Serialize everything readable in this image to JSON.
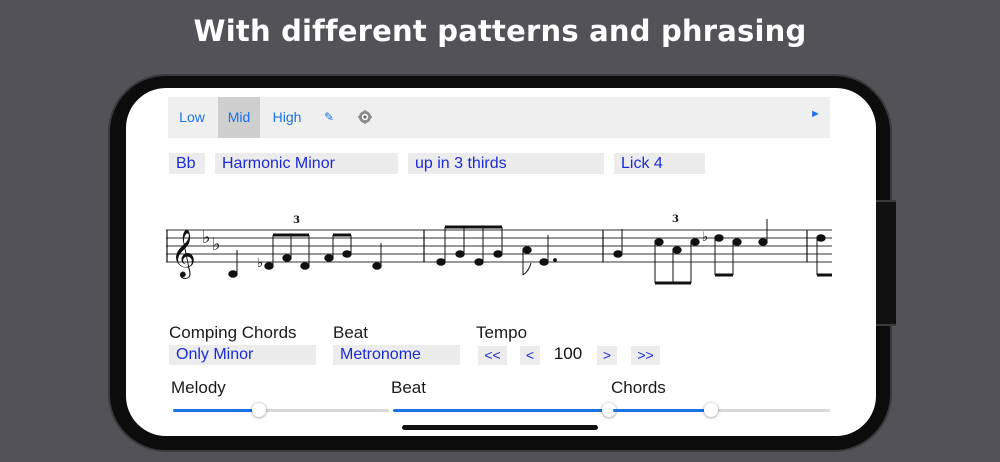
{
  "headline": "With different patterns and phrasing",
  "toolbar": {
    "low": "Low",
    "mid": "Mid",
    "high": "High",
    "edit_icon": "pencil-icon",
    "settings_icon": "gear-icon",
    "play_icon": "play-icon",
    "pencil_glyph": "✎",
    "play_glyph": "►",
    "active": "Mid"
  },
  "selectors": {
    "key": "Bb",
    "scale": "Harmonic Minor",
    "pattern": "up in 3 thirds",
    "lick": "Lick 4"
  },
  "score": {
    "triplet_marks": [
      "3",
      "3"
    ],
    "clef": "treble-clef",
    "key_signature": "2 flats"
  },
  "controls": {
    "comping_label": "Comping Chords",
    "comping_value": "Only Minor",
    "beat_label": "Beat",
    "beat_value": "Metronome",
    "tempo_label": "Tempo",
    "tempo_buttons": [
      "<<",
      "<",
      ">",
      ">>"
    ],
    "tempo_value": "100"
  },
  "mixer": {
    "melody_label": "Melody",
    "beat_label": "Beat",
    "chords_label": "Chords",
    "melody_level": 0.4,
    "beat_level": 1.0,
    "chords_level": 0.45
  },
  "colors": {
    "accent": "#1a73e8",
    "value_text": "#1a2bd6",
    "background": "#535357"
  }
}
